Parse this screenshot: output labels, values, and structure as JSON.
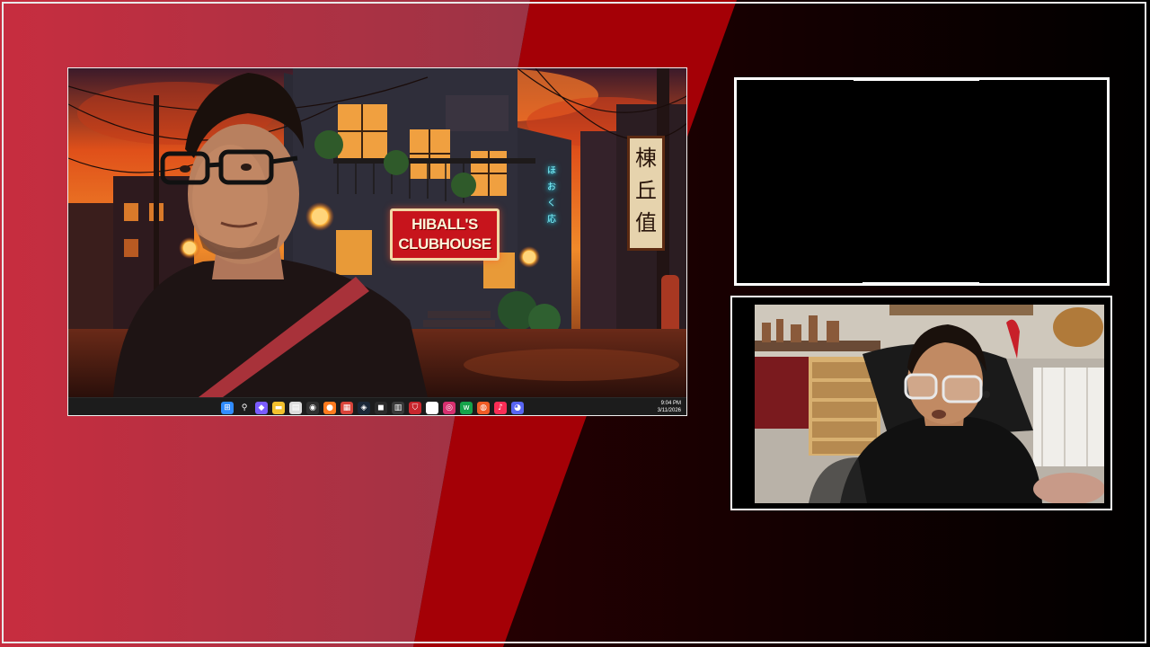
{
  "desktop": {
    "sign": {
      "line1": "HIBALL'S",
      "line2": "CLUBHOUSE"
    },
    "kanji_sign": [
      "棟",
      "丘",
      "值"
    ],
    "neon_sign": [
      "ほ",
      "お",
      "く",
      "応"
    ],
    "taskbar": {
      "icons": [
        {
          "name": "windows-start-icon",
          "glyph": "⊞",
          "color": "#2f8cff"
        },
        {
          "name": "search-icon",
          "glyph": "⚲",
          "color": "#1c1c1c"
        },
        {
          "name": "copilot-icon",
          "glyph": "◆",
          "color": "#7a5cff"
        },
        {
          "name": "file-explorer-icon",
          "glyph": "▬",
          "color": "#f2c12e"
        },
        {
          "name": "notepad-icon",
          "glyph": "▤",
          "color": "#dcdcdc"
        },
        {
          "name": "obs-icon",
          "glyph": "◉",
          "color": "#303030"
        },
        {
          "name": "firefox-icon",
          "glyph": "●",
          "color": "#ff7b1f"
        },
        {
          "name": "calendar-icon",
          "glyph": "▦",
          "color": "#d8443a"
        },
        {
          "name": "steam-icon",
          "glyph": "◈",
          "color": "#1b2838"
        },
        {
          "name": "epic-games-icon",
          "glyph": "◼",
          "color": "#2b2b2b"
        },
        {
          "name": "document-icon",
          "glyph": "▥",
          "color": "#3a3a3a"
        },
        {
          "name": "shield-icon",
          "glyph": "⛉",
          "color": "#c8262d"
        },
        {
          "name": "controller-icon",
          "glyph": "◐",
          "color": "#ffffff"
        },
        {
          "name": "instagram-icon",
          "glyph": "◎",
          "color": "#d6306f"
        },
        {
          "name": "wps-icon",
          "glyph": "w",
          "color": "#15a34a"
        },
        {
          "name": "ea-icon",
          "glyph": "◍",
          "color": "#ef5b25"
        },
        {
          "name": "apple-music-icon",
          "glyph": "♪",
          "color": "#fa2d55"
        },
        {
          "name": "discord-icon",
          "glyph": "◕",
          "color": "#5865f2"
        }
      ],
      "time": "9:04 PM",
      "date": "3/11/2026"
    }
  }
}
